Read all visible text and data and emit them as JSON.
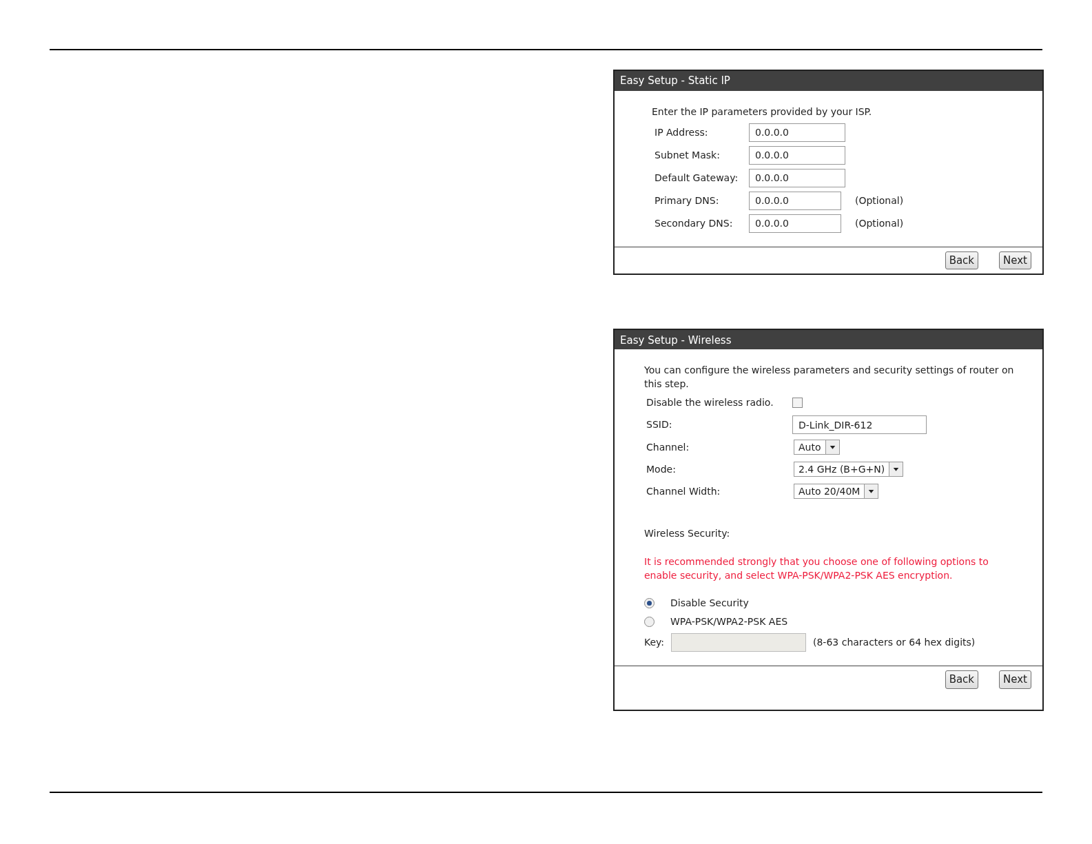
{
  "static_ip": {
    "title": "Easy Setup - Static IP",
    "intro": "Enter the IP parameters provided by your ISP.",
    "fields": [
      {
        "label": "IP Address:",
        "value": "0.0.0.0"
      },
      {
        "label": "Subnet Mask:",
        "value": "0.0.0.0"
      },
      {
        "label": "Default Gateway:",
        "value": "0.0.0.0"
      },
      {
        "label": "Primary DNS:",
        "value": "0.0.0.0",
        "note": "(Optional)"
      },
      {
        "label": "Secondary DNS:",
        "value": "0.0.0.0",
        "note": "(Optional)"
      }
    ],
    "buttons": [
      "Back",
      "Next"
    ]
  },
  "wireless": {
    "title": "Easy Setup - Wireless",
    "intro": "You can configure the wireless parameters and security settings of router on this step.",
    "rows": [
      {
        "kind": "checkbox",
        "label": "Disable the wireless radio.",
        "checked": false
      },
      {
        "kind": "text",
        "label": "SSID:",
        "value": "D-Link_DIR-612"
      },
      {
        "kind": "select",
        "label": "Channel:",
        "value": "Auto"
      },
      {
        "kind": "select",
        "label": "Mode:",
        "value": "2.4 GHz (B+G+N)"
      },
      {
        "kind": "select",
        "label": "Channel Width:",
        "value": "Auto 20/40M"
      }
    ],
    "security_label": "Wireless Security:",
    "warning": "It is recommended strongly that you choose one of following options to enable security, and select WPA-PSK/WPA2-PSK AES encryption.",
    "options": [
      {
        "label": "Disable Security",
        "selected": true
      },
      {
        "label": "WPA-PSK/WPA2-PSK AES",
        "selected": false
      }
    ],
    "key": {
      "label": "Key:",
      "disabled": true,
      "hint": "(8-63 characters or 64 hex digits)"
    },
    "buttons": [
      "Back",
      "Next"
    ]
  }
}
